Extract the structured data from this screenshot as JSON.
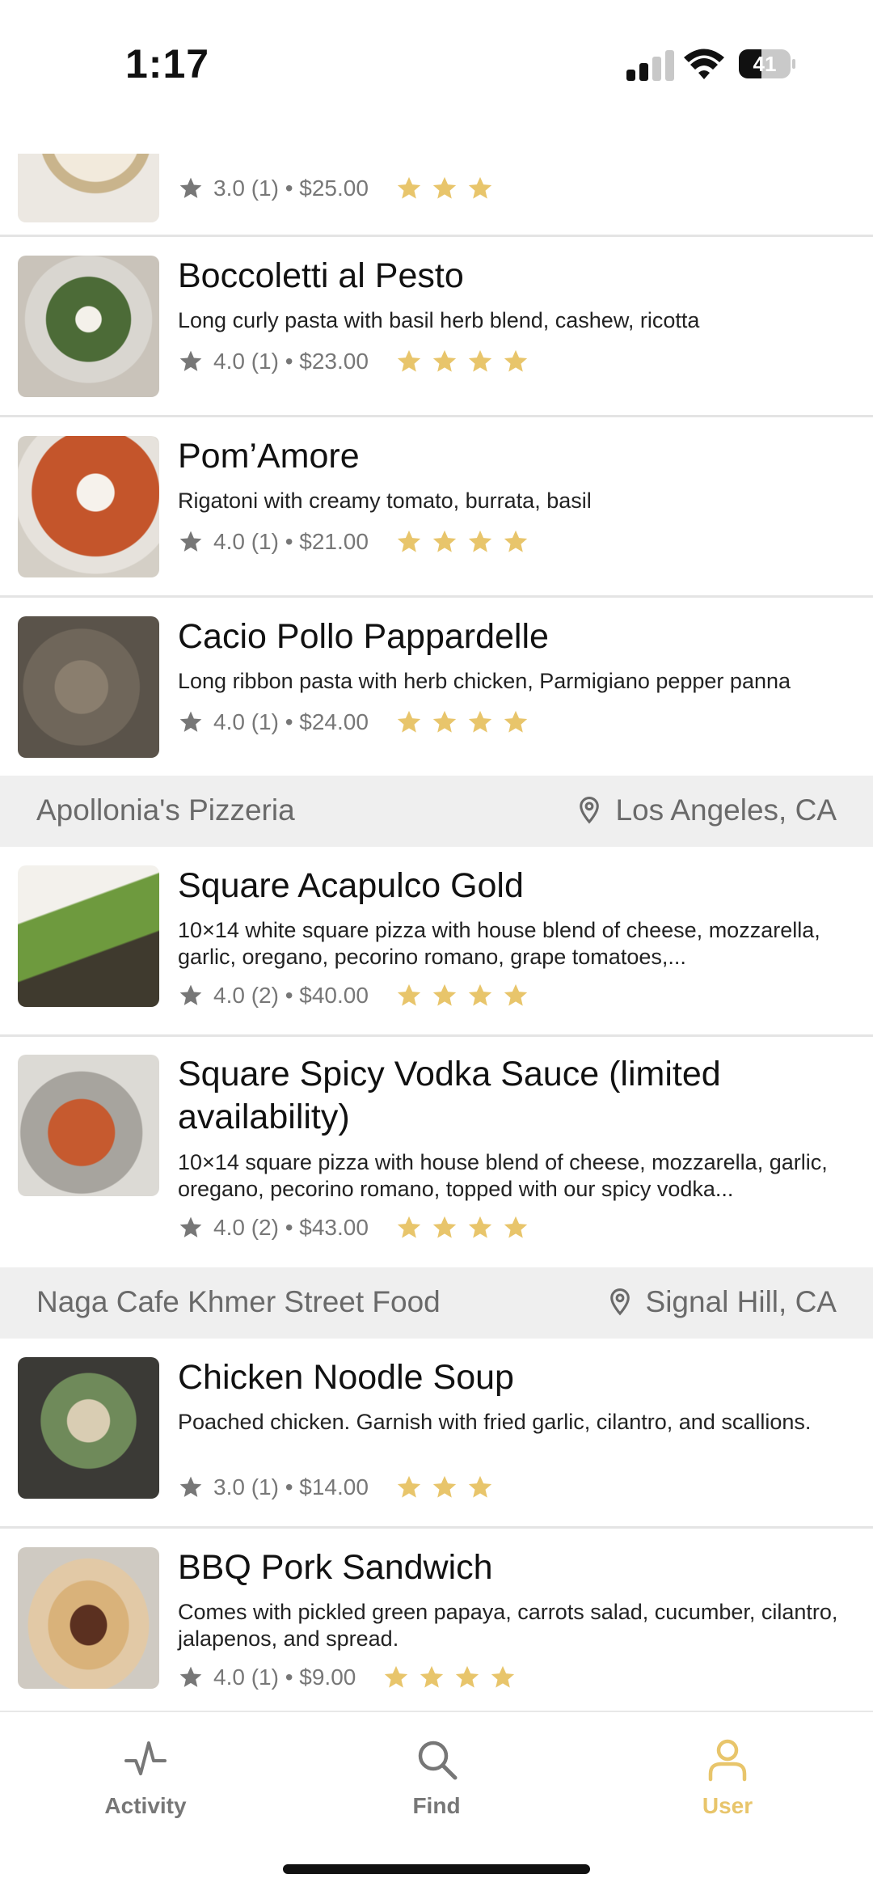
{
  "status_bar": {
    "time": "1:17",
    "battery": "41"
  },
  "colors": {
    "accent": "#e8c56b",
    "star": "#e8c56b",
    "grey_star": "#777777"
  },
  "items_top": [
    {
      "name": "",
      "description": "",
      "rating_line": "3.0 (1) • $25.00",
      "stars": 3
    },
    {
      "name": "Boccoletti al Pesto",
      "description": "Long curly pasta with basil herb blend, cashew, ricotta",
      "rating_line": "4.0 (1) • $23.00",
      "stars": 4
    },
    {
      "name": "Pom’Amore",
      "description": "Rigatoni with creamy tomato, burrata, basil",
      "rating_line": "4.0 (1) • $21.00",
      "stars": 4
    },
    {
      "name": "Cacio Pollo Pappardelle",
      "description": "Long ribbon pasta with herb chicken, Parmigiano pepper panna",
      "rating_line": "4.0 (1) • $24.00",
      "stars": 4
    }
  ],
  "section_apollonia": {
    "restaurant": "Apollonia's Pizzeria",
    "location": "Los Angeles, CA",
    "items": [
      {
        "name": "Square Acapulco Gold",
        "description": "10×14 white square pizza with house blend of cheese, mozzarella, garlic, oregano, pecorino romano, grape tomatoes,...",
        "rating_line": "4.0 (2) • $40.00",
        "stars": 4
      },
      {
        "name": "Square Spicy Vodka Sauce (limited availability)",
        "description": "10×14 square pizza with house blend of cheese, mozzarella, garlic, oregano, pecorino romano, topped with our spicy vodka...",
        "rating_line": "4.0 (2) • $43.00",
        "stars": 4
      }
    ]
  },
  "section_naga": {
    "restaurant": "Naga Cafe Khmer Street Food",
    "location": "Signal Hill, CA",
    "items": [
      {
        "name": "Chicken Noodle Soup",
        "description": "Poached chicken. Garnish with fried garlic, cilantro, and scallions.",
        "rating_line": "3.0 (1) • $14.00",
        "stars": 3
      },
      {
        "name": "BBQ Pork Sandwich",
        "description": "Comes with pickled green papaya, carrots salad, cucumber, cilantro, jalapenos, and spread.",
        "rating_line": "4.0 (1) • $9.00",
        "stars": 4
      }
    ]
  },
  "tabbar": {
    "tabs": [
      {
        "label": "Activity",
        "icon": "activity-icon"
      },
      {
        "label": "Find",
        "icon": "search-icon"
      },
      {
        "label": "User",
        "icon": "user-icon",
        "active": true
      }
    ]
  }
}
